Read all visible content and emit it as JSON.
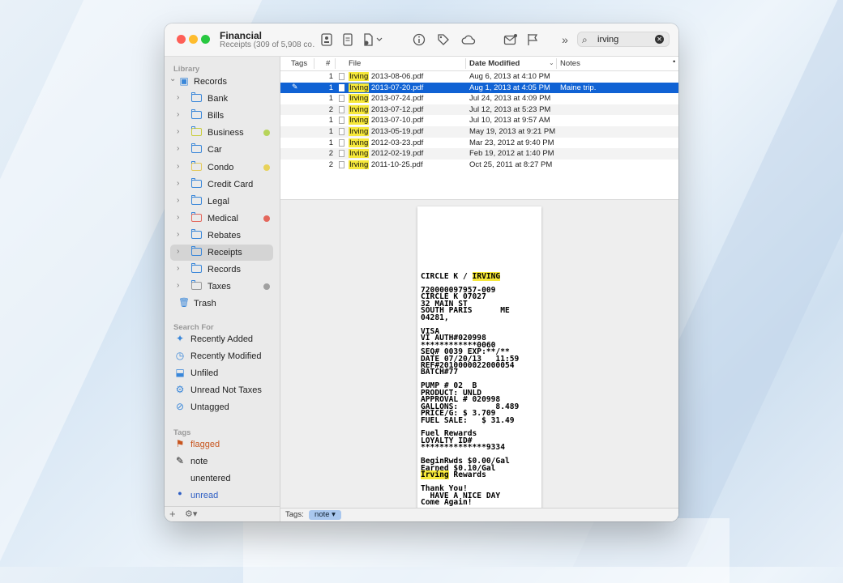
{
  "window": {
    "title": "Financial",
    "subtitle": "Receipts (309 of 5,908 co…"
  },
  "search": {
    "value": "irving"
  },
  "sidebar": {
    "library_heading": "Library",
    "library": [
      {
        "label": "Records",
        "kind": "root"
      },
      {
        "label": "Bank",
        "kind": "folder",
        "color": "#3a87d9"
      },
      {
        "label": "Bills",
        "kind": "folder",
        "color": "#3a87d9"
      },
      {
        "label": "Business",
        "kind": "folder",
        "color": "#c9cd3c",
        "dot": "#b7d45a"
      },
      {
        "label": "Car",
        "kind": "folder",
        "color": "#3a87d9"
      },
      {
        "label": "Condo",
        "kind": "folder",
        "color": "#e3c95a",
        "dot": "#e8d25a"
      },
      {
        "label": "Credit Card",
        "kind": "folder",
        "color": "#3a87d9"
      },
      {
        "label": "Legal",
        "kind": "folder",
        "color": "#3a87d9"
      },
      {
        "label": "Medical",
        "kind": "folder",
        "color": "#e4675c",
        "dot": "#e4675c"
      },
      {
        "label": "Rebates",
        "kind": "folder",
        "color": "#3a87d9"
      },
      {
        "label": "Receipts",
        "kind": "folder",
        "color": "#3a87d9",
        "selected": true
      },
      {
        "label": "Records",
        "kind": "folder",
        "color": "#3a87d9"
      },
      {
        "label": "Taxes",
        "kind": "folder",
        "color": "#9a9a9a",
        "dot": "#a0a0a0"
      },
      {
        "label": "Trash",
        "kind": "trash"
      }
    ],
    "search_heading": "Search For",
    "searches": [
      {
        "label": "Recently Added",
        "icon": "sparkle-icon"
      },
      {
        "label": "Recently Modified",
        "icon": "clock-icon"
      },
      {
        "label": "Unfiled",
        "icon": "tray-icon"
      },
      {
        "label": "Unread Not Taxes",
        "icon": "gear-icon"
      },
      {
        "label": "Untagged",
        "icon": "tag-slash-icon"
      }
    ],
    "tags_heading": "Tags",
    "tags": [
      {
        "label": "flagged",
        "icon": "flag-icon",
        "color": "#c8551e"
      },
      {
        "label": "note",
        "icon": "pencil-icon",
        "color": "#222222"
      },
      {
        "label": "unentered",
        "icon": "none",
        "color": "#222222"
      },
      {
        "label": "unread",
        "icon": "dot-icon",
        "color": "#2f5fc4"
      }
    ]
  },
  "table": {
    "columns": {
      "tags": "Tags",
      "num": "#",
      "file": "File",
      "date": "Date Modified",
      "notes": "Notes"
    },
    "rows": [
      {
        "num": "1",
        "hl": "Irving",
        "rest": " 2013-08-06.pdf",
        "date": "Aug 6, 2013 at 4:10 PM",
        "note": "",
        "tag": ""
      },
      {
        "num": "1",
        "hl": "Irving",
        "rest": " 2013-07-20.pdf",
        "date": "Aug 1, 2013 at 4:05 PM",
        "note": "Maine trip.",
        "tag": "✎",
        "selected": true
      },
      {
        "num": "1",
        "hl": "Irving",
        "rest": " 2013-07-24.pdf",
        "date": "Jul 24, 2013 at 4:09 PM",
        "note": "",
        "tag": ""
      },
      {
        "num": "2",
        "hl": "Irving",
        "rest": " 2013-07-12.pdf",
        "date": "Jul 12, 2013 at 5:23 PM",
        "note": "",
        "tag": ""
      },
      {
        "num": "1",
        "hl": "Irving",
        "rest": " 2013-07-10.pdf",
        "date": "Jul 10, 2013 at 9:57 AM",
        "note": "",
        "tag": ""
      },
      {
        "num": "1",
        "hl": "Irving",
        "rest": " 2013-05-19.pdf",
        "date": "May 19, 2013 at 9:21 PM",
        "note": "",
        "tag": ""
      },
      {
        "num": "1",
        "hl": "Irving",
        "rest": " 2012-03-23.pdf",
        "date": "Mar 23, 2012 at 9:40 PM",
        "note": "",
        "tag": ""
      },
      {
        "num": "2",
        "hl": "Irving",
        "rest": " 2012-02-19.pdf",
        "date": "Feb 19, 2012 at 1:40 PM",
        "note": "",
        "tag": ""
      },
      {
        "num": "2",
        "hl": "Irving",
        "rest": " 2011-10-25.pdf",
        "date": "Oct 25, 2011 at 8:27 PM",
        "note": "",
        "tag": ""
      }
    ]
  },
  "receipt": {
    "lines": [
      {
        "t": "CIRCLE K / ",
        "hl": "IRVING"
      },
      {
        "t": "720000097957-009"
      },
      {
        "t": "CIRCLE K 07027"
      },
      {
        "t": "32 MAIN ST"
      },
      {
        "t": "SOUTH PARIS      ME"
      },
      {
        "t": "04281,"
      },
      {
        "t": ""
      },
      {
        "t": "VISA"
      },
      {
        "t": "VI AUTH#020998"
      },
      {
        "t": "************0060"
      },
      {
        "t": "SEQ# 0039 EXP:**/**"
      },
      {
        "t": "DATE 07/20/13   11:59"
      },
      {
        "t": "REF#2010000022000054"
      },
      {
        "t": "BATCH#77"
      },
      {
        "t": ""
      },
      {
        "t": "PUMP # 02  B"
      },
      {
        "t": "PRODUCT: UNLD"
      },
      {
        "t": "APPROVAL # 020998"
      },
      {
        "t": "GALLONS:        8.489"
      },
      {
        "t": "PRICE/G: $ 3.709"
      },
      {
        "t": "FUEL SALE:   $ 31.49"
      },
      {
        "t": ""
      },
      {
        "t": "Fuel Rewards"
      },
      {
        "t": "LOYALTY ID#"
      },
      {
        "t": "**************9334"
      },
      {
        "t": ""
      },
      {
        "t": "BeginRwds $0.00/Gal"
      },
      {
        "t": "Earned $0.10/Gal"
      },
      {
        "t": " Rewards",
        "hl_first": "Irving"
      },
      {
        "t": ""
      },
      {
        "t": "Thank You!"
      },
      {
        "t": "  HAVE A NICE DAY"
      },
      {
        "t": "Come Again!"
      }
    ]
  },
  "bottom": {
    "tags_label": "Tags:",
    "tag_value": "note"
  }
}
